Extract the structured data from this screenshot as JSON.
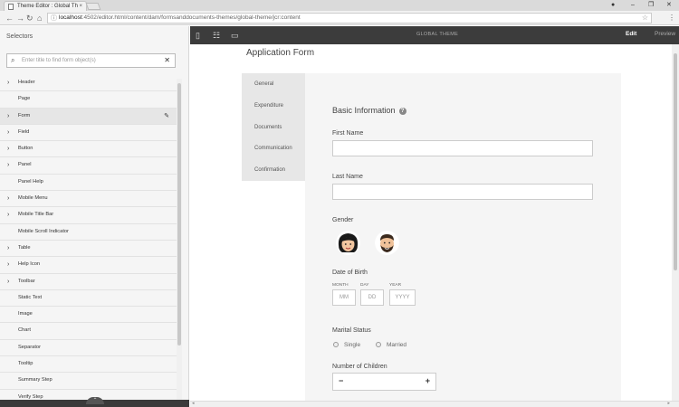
{
  "browser": {
    "tab_title": "Theme Editor : Global Th",
    "tab_close": "×",
    "url_host": "localhost",
    "url_path": ":4502/editor.html/content/dam/formsanddocuments-themes/global-theme/jcr:content",
    "back": "←",
    "forward": "→",
    "reload": "↻",
    "home": "⌂",
    "star": "☆",
    "menu": "⋮",
    "account": "●",
    "minimize": "–",
    "maximize": "❐",
    "close": "✕"
  },
  "left_panel": {
    "title": "Selectors",
    "search_placeholder": "Enter title to find form object(s)",
    "search_icon": "⌕",
    "clear_icon": "✕",
    "items": [
      {
        "label": "Header",
        "has_children": true
      },
      {
        "label": "Page",
        "has_children": false
      },
      {
        "label": "Form",
        "has_children": true,
        "active": true
      },
      {
        "label": "Field",
        "has_children": true
      },
      {
        "label": "Button",
        "has_children": true
      },
      {
        "label": "Panel",
        "has_children": true
      },
      {
        "label": "Panel Help",
        "has_children": false
      },
      {
        "label": "Mobile Menu",
        "has_children": true
      },
      {
        "label": "Mobile Title Bar",
        "has_children": true
      },
      {
        "label": "Mobile Scroll Indicator",
        "has_children": false
      },
      {
        "label": "Table",
        "has_children": true
      },
      {
        "label": "Help Icon",
        "has_children": true
      },
      {
        "label": "Toolbar",
        "has_children": true
      },
      {
        "label": "Static Text",
        "has_children": false
      },
      {
        "label": "Image",
        "has_children": false
      },
      {
        "label": "Chart",
        "has_children": false
      },
      {
        "label": "Separator",
        "has_children": false
      },
      {
        "label": "Tooltip",
        "has_children": false
      },
      {
        "label": "Summary Step",
        "has_children": false
      },
      {
        "label": "Verify Step",
        "has_children": false
      }
    ],
    "chevron": "›",
    "edit_icon": "✎",
    "collapse_handle": "⌃"
  },
  "toolbar": {
    "center_label": "GLOBAL THEME",
    "edit_label": "Edit",
    "preview_label": "Preview",
    "sidepanel_icon": "▯",
    "properties_icon": "☷",
    "comment_icon": "▭"
  },
  "form": {
    "title": "Application Form",
    "tabs": [
      "General",
      "Expenditure",
      "Documents",
      "Communication",
      "Confirmation"
    ],
    "section_title": "Basic Information",
    "help_icon": "?",
    "first_name_label": "First Name",
    "last_name_label": "Last Name",
    "gender_label": "Gender",
    "dob_label": "Date of Birth",
    "dob_month_caption": "MONTH",
    "dob_day_caption": "DAY",
    "dob_year_caption": "YEAR",
    "dob_month_placeholder": "MM",
    "dob_day_placeholder": "DD",
    "dob_year_placeholder": "YYYY",
    "marital_label": "Marital Status",
    "marital_options": [
      "Single",
      "Married"
    ],
    "children_label": "Number of Children",
    "stepper_minus": "−",
    "stepper_plus": "+"
  },
  "scrollbars": {
    "left_arrow": "◂",
    "right_arrow": "▸"
  }
}
